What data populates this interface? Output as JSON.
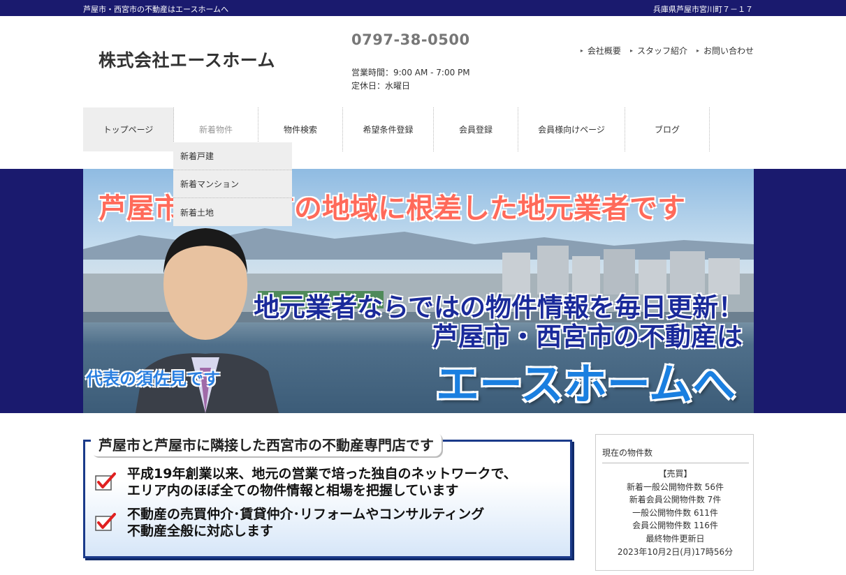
{
  "topbar": {
    "tagline": "芦屋市・西宮市の不動産はエースホームへ",
    "address": "兵庫県芦屋市宮川町７－１７"
  },
  "header": {
    "company": "株式会社エースホーム",
    "phone": "0797-38-0500",
    "hours": "営業時間：9:00 AM - 7:00 PM",
    "holiday": "定休日：水曜日",
    "links": [
      {
        "label": "会社概要"
      },
      {
        "label": "スタッフ紹介"
      },
      {
        "label": "お問い合わせ"
      }
    ]
  },
  "nav": {
    "items": [
      {
        "label": "トップページ"
      },
      {
        "label": "新着物件"
      },
      {
        "label": "物件検索"
      },
      {
        "label": "希望条件登録"
      },
      {
        "label": "会員登録"
      },
      {
        "label": "会員様向けページ"
      },
      {
        "label": "ブログ"
      }
    ],
    "dropdown": [
      {
        "label": "新着戸建"
      },
      {
        "label": "新着マンション"
      },
      {
        "label": "新着土地"
      }
    ]
  },
  "hero": {
    "headline": "芦屋市・西宮市の地域に根差した地元業者です",
    "line2": "地元業者ならではの物件情報を毎日更新！",
    "line3": "芦屋市・西宮市の不動産は",
    "brand": "エースホームへ",
    "rep": "代表の須佐見です"
  },
  "feature": {
    "title": "芦屋市と芦屋市に隣接した西宮市の不動産専門店です",
    "items": [
      {
        "line1": "平成19年創業以来、地元の営業で培った独自のネットワークで、",
        "line2": "エリア内のほぼ全ての物件情報と相場を把握しています"
      },
      {
        "line1": "不動産の売買仲介･賃貸仲介･リフォームやコンサルティング",
        "line2": "不動産全般に対応します"
      }
    ]
  },
  "sidebox": {
    "heading": "現在の物件数",
    "section": "【売買】",
    "rows": [
      "新着一般公開物件数 56件",
      "新着会員公開物件数 7件",
      "一般公開物件数 611件",
      "会員公開物件数 116件",
      "最終物件更新日",
      "2023年10月2日(月)17時56分"
    ]
  },
  "colors": {
    "navy": "#1a1a6e",
    "accent_red": "#ff6a5a",
    "accent_blue": "#1a7fe0",
    "check_red": "#e02020"
  },
  "icons": [
    "chevron-right-icon",
    "checkmark-icon"
  ]
}
